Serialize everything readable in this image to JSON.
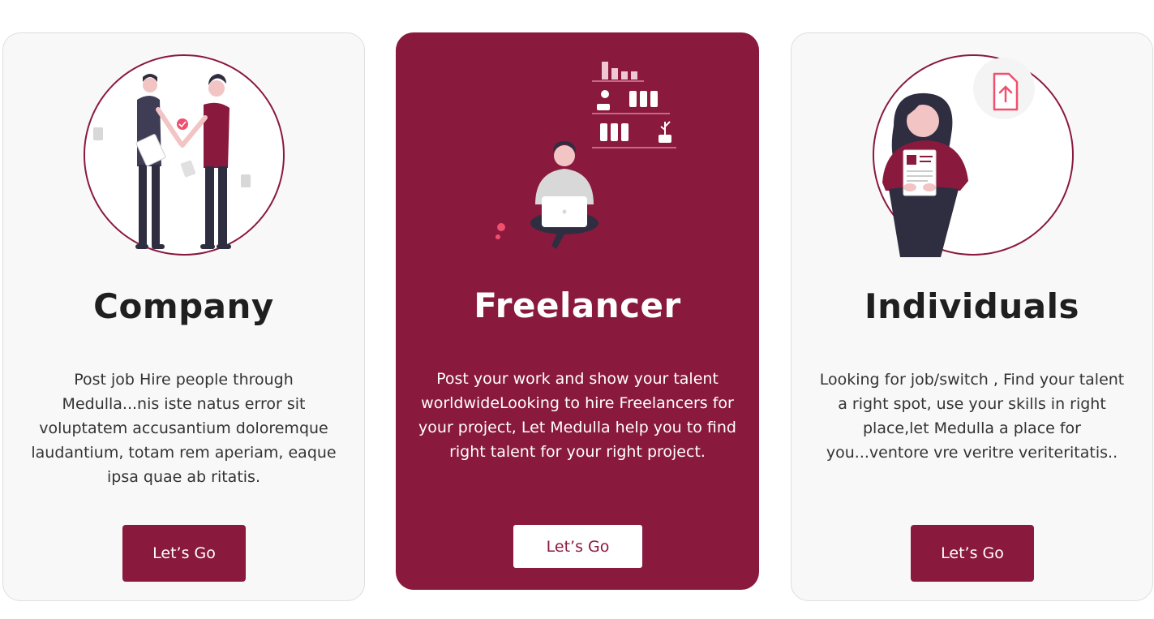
{
  "colors": {
    "accent": "#8a193e",
    "card_bg": "#f8f8f8",
    "text_dark": "#1f1f1f",
    "highlight_pink": "#f0506e"
  },
  "cards": [
    {
      "title": "Company",
      "description": "Post job Hire people through Medulla...nis iste natus error sit voluptatem accusantium doloremque laudantium, totam rem aperiam, eaque ipsa quae ab ritatis.",
      "button_label": "Let’s Go",
      "illustration": "handshake-illustration"
    },
    {
      "title": "Freelancer",
      "description": "Post your work and show your talent worldwideLooking to hire Freelancers for your project, Let Medulla help you to find right talent for your right project.",
      "button_label": "Let’s Go",
      "illustration": "laptop-worker-illustration"
    },
    {
      "title": "Individuals",
      "description": "Looking for job/switch , Find your talent a right spot, use your skills in right place,let Medulla a place for you...ventore vre veritre veriteritatis..",
      "button_label": "Let’s Go",
      "illustration": "resume-upload-illustration"
    }
  ]
}
